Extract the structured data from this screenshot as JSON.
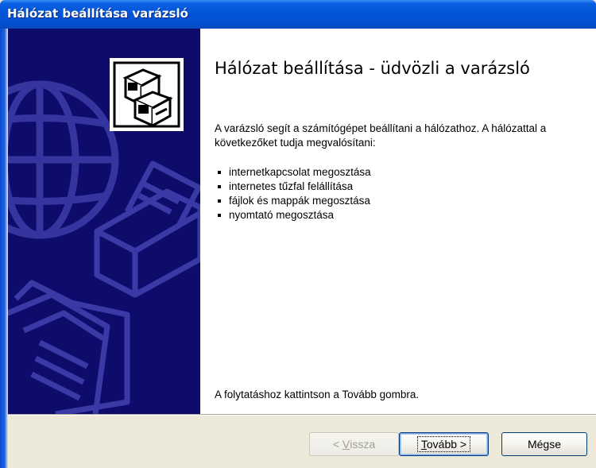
{
  "window": {
    "title": "Hálózat beállítása varázsló"
  },
  "content": {
    "heading": "Hálózat beállítása - üdvözli a varázsló",
    "intro": "A varázsló segít a számítógépet beállítani a hálózathoz. A hálózattal a következőket tudja megvalósítani:",
    "bullets": [
      "internetkapcsolat megosztása",
      "internetes tűzfal felállítása",
      "fájlok és mappák megosztása",
      "nyomtató megosztása"
    ],
    "footer": "A folytatáshoz kattintson a Tovább gombra."
  },
  "buttons": {
    "back": {
      "prefix": "< ",
      "accel": "V",
      "rest": "issza",
      "enabled": false
    },
    "next": {
      "accel": "T",
      "rest": "ovább >",
      "default": true
    },
    "cancel": {
      "label": "Mégse"
    }
  },
  "icons": {
    "wizard": "network-computers-icon",
    "background": [
      "globe-icon",
      "printer-icon",
      "folder-documents-icon"
    ]
  },
  "colors": {
    "titlebar": "#0254d6",
    "left_panel": "#0e0c6b",
    "dialog_face": "#ece9d8"
  }
}
